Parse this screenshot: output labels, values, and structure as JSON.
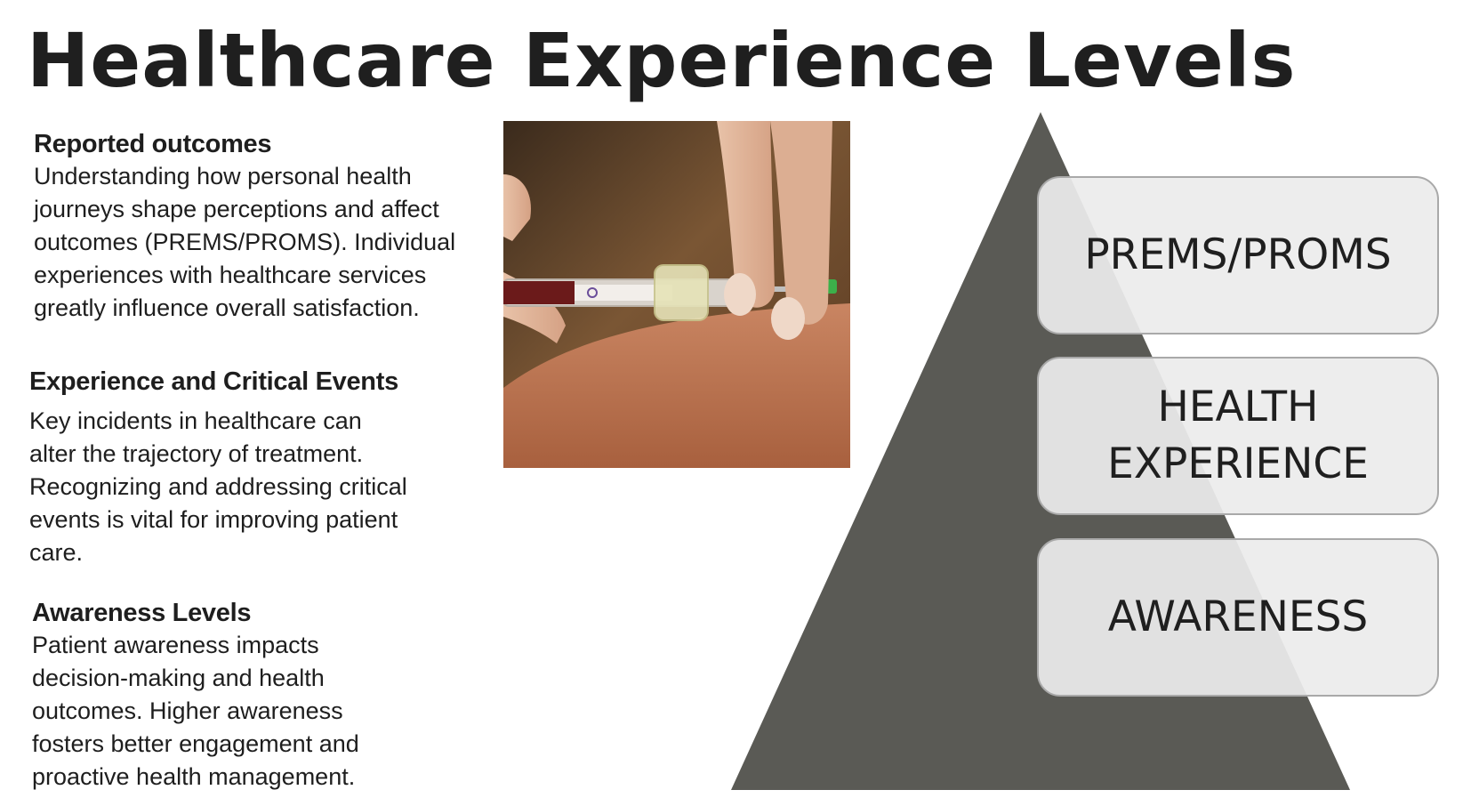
{
  "title": "Healthcare Experience Levels",
  "sections": [
    {
      "heading": "Reported outcomes",
      "body": "Understanding how personal health\njourneys shape perceptions and affect\noutcomes (PREMS/PROMS). Individual\nexperiences with healthcare services\ngreatly influence overall satisfaction."
    },
    {
      "heading": "Experience and Critical Events",
      "body": "Key incidents in healthcare can\nalter the trajectory of treatment.\nRecognizing and addressing critical\nevents is vital for improving patient\ncare."
    },
    {
      "heading": "Awareness Levels",
      "body": "Patient awareness impacts\ndecision-making and health\noutcomes. Higher awareness\nfosters better engagement and\nproactive health management."
    }
  ],
  "pyramid": {
    "levels": [
      "PREMS/PROMS",
      "HEALTH\nEXPERIENCE",
      "AWARENESS"
    ],
    "fill_color": "#5a5a55",
    "box_color": "#ececec"
  },
  "photo": {
    "icon": "blood-draw-syringe-photo"
  }
}
